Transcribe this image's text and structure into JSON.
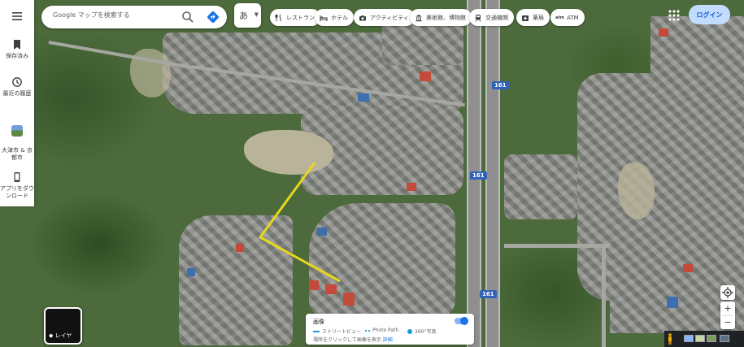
{
  "search": {
    "placeholder": "Google マップを検索する"
  },
  "lang": {
    "label": "あ"
  },
  "rail": {
    "saved_label": "保存済み",
    "recent_label": "最近の履歴",
    "place_label": "大津市 & 京都市",
    "app_label": "アプリをダウンロード"
  },
  "chips": [
    {
      "label": "レストラン",
      "icon": "fork-knife-icon"
    },
    {
      "label": "ホテル",
      "icon": "bed-icon"
    },
    {
      "label": "アクティビティ",
      "icon": "camera-icon"
    },
    {
      "label": "美術館、博物館",
      "icon": "museum-icon"
    },
    {
      "label": "交通機関",
      "icon": "train-icon"
    },
    {
      "label": "薬局",
      "icon": "pharmacy-icon"
    },
    {
      "label": "ATM",
      "icon": "atm-icon"
    }
  ],
  "login": {
    "label": "ログイン"
  },
  "layers": {
    "label": "レイヤ"
  },
  "imagery": {
    "title": "画像",
    "legend": {
      "street_view": "ストリートビュー",
      "photo_path": "Photo Path",
      "photo_360": "360°写真"
    },
    "hint": "場所をクリックして画像を表示",
    "hint_link": "詳細",
    "toggle_on": true
  },
  "map": {
    "route_shield": "161",
    "route_color": "#e6d81e",
    "accent": "#1a73e8"
  }
}
